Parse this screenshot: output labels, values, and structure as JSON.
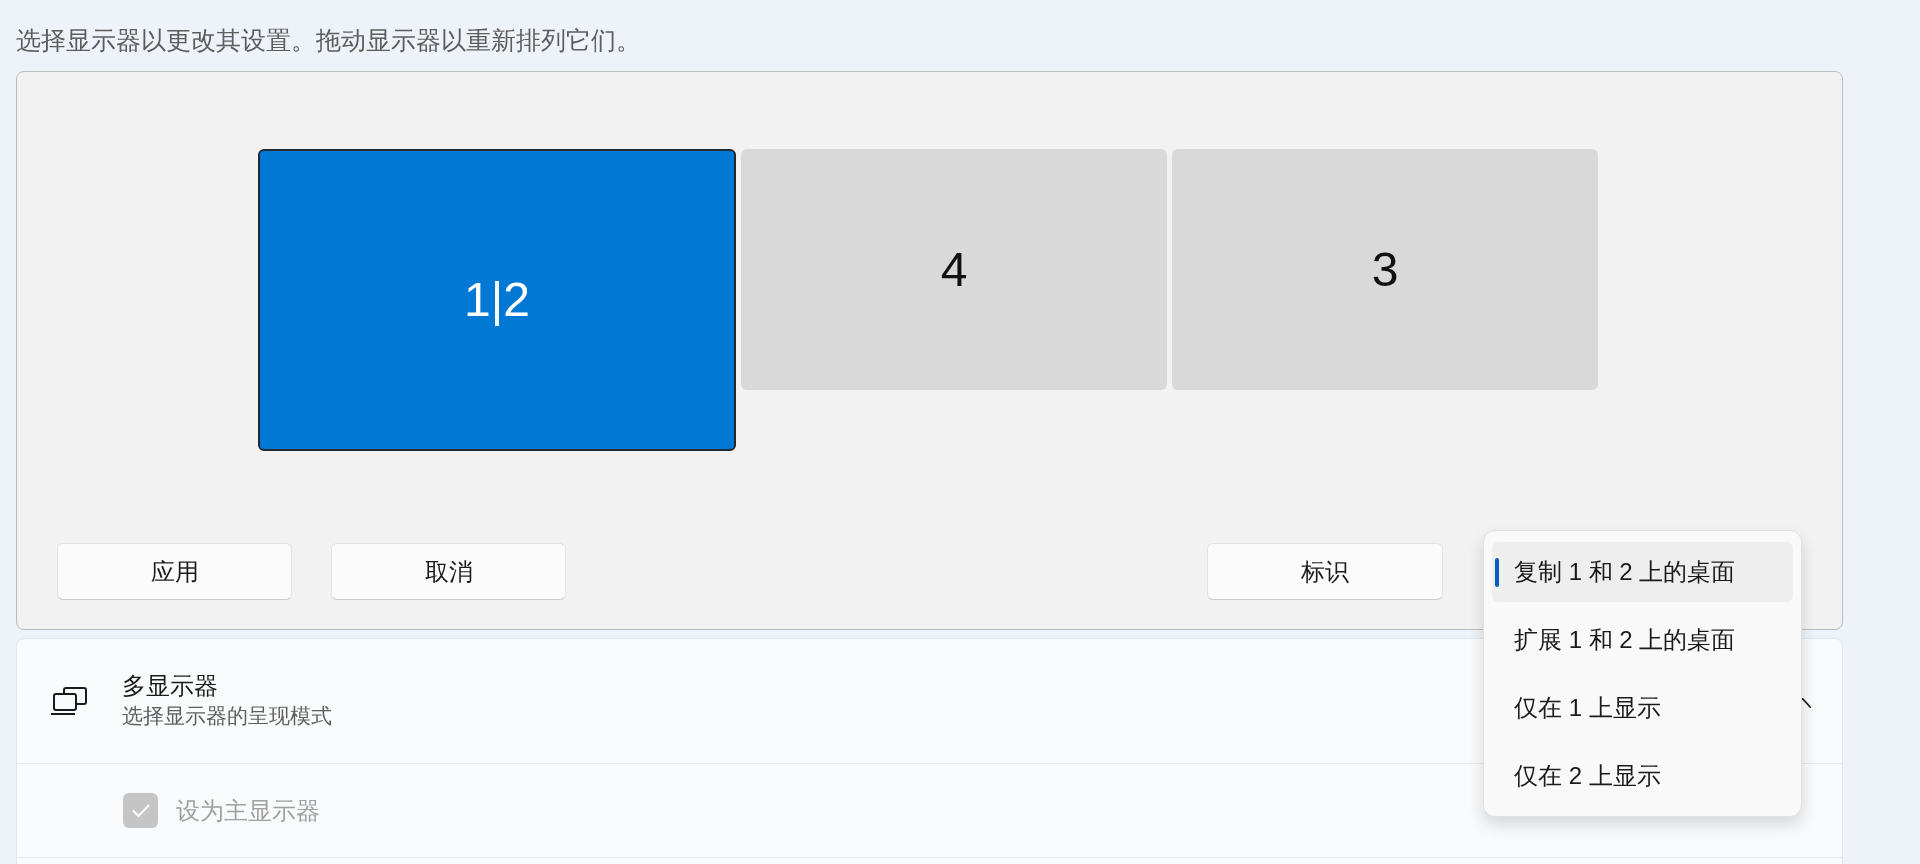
{
  "instruction": "选择显示器以更改其设置。拖动显示器以重新排列它们。",
  "displays": [
    {
      "label": "1|2",
      "selected": true
    },
    {
      "label": "4",
      "selected": false
    },
    {
      "label": "3",
      "selected": false
    }
  ],
  "buttons": [
    "应用",
    "取消"
  ],
  "identify_button": "标识",
  "multiple_displays": {
    "title": "多显示器",
    "subtitle": "选择显示器的呈现模式",
    "expanded": true
  },
  "primary_display": {
    "label": "设为主显示器",
    "checked": true,
    "disabled": true
  },
  "display_mode_menu": {
    "options": [
      {
        "label": "复制 1 和 2 上的桌面",
        "selected": true
      },
      {
        "label": "扩展 1 和 2 上的桌面",
        "selected": false
      },
      {
        "label": "仅在 1 上显示",
        "selected": false
      },
      {
        "label": "仅在 2 上显示",
        "selected": false
      }
    ]
  }
}
